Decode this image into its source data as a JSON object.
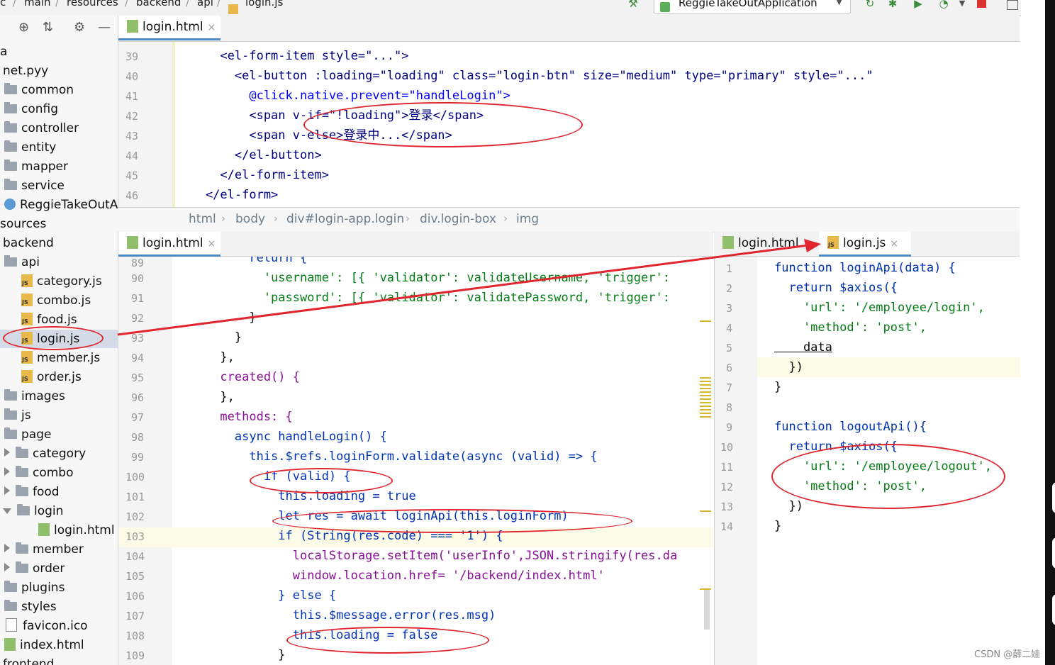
{
  "breadcrumb": [
    "c",
    "main",
    "resources",
    "backend",
    "api",
    "login.js"
  ],
  "run_config": {
    "label": "ReggieTakeOutApplication"
  },
  "project": {
    "items": [
      {
        "label": "a",
        "kind": "text"
      },
      {
        "label": "net.pyy",
        "kind": "text"
      },
      {
        "label": "common",
        "kind": "folder"
      },
      {
        "label": "config",
        "kind": "folder"
      },
      {
        "label": "controller",
        "kind": "folder"
      },
      {
        "label": "entity",
        "kind": "folder"
      },
      {
        "label": "mapper",
        "kind": "folder"
      },
      {
        "label": "service",
        "kind": "folder"
      },
      {
        "label": "ReggieTakeOutA|",
        "kind": "class"
      },
      {
        "label": "sources",
        "kind": "text"
      },
      {
        "label": "backend",
        "kind": "text"
      },
      {
        "label": "api",
        "kind": "folder"
      },
      {
        "label": "category.js",
        "kind": "js"
      },
      {
        "label": "combo.js",
        "kind": "js"
      },
      {
        "label": "food.js",
        "kind": "js"
      },
      {
        "label": "login.js",
        "kind": "js"
      },
      {
        "label": "member.js",
        "kind": "js"
      },
      {
        "label": "order.js",
        "kind": "js"
      },
      {
        "label": "images",
        "kind": "folder"
      },
      {
        "label": "js",
        "kind": "folder"
      },
      {
        "label": "page",
        "kind": "folder"
      },
      {
        "label": "category",
        "kind": "folder"
      },
      {
        "label": "combo",
        "kind": "folder"
      },
      {
        "label": "food",
        "kind": "folder"
      },
      {
        "label": "login",
        "kind": "folder"
      },
      {
        "label": "login.html",
        "kind": "html"
      },
      {
        "label": "member",
        "kind": "folder"
      },
      {
        "label": "order",
        "kind": "folder"
      },
      {
        "label": "plugins",
        "kind": "folder"
      },
      {
        "label": "styles",
        "kind": "folder"
      },
      {
        "label": "favicon.ico",
        "kind": "ico"
      },
      {
        "label": "index.html",
        "kind": "html"
      },
      {
        "label": "frontend",
        "kind": "text"
      }
    ]
  },
  "tabs": {
    "top": "login.html",
    "bottom_left": "login.html",
    "right_first": "login.html",
    "right_second": "login.js",
    "close": "×"
  },
  "path_bar": [
    "html",
    "body",
    "div#login-app.login",
    "div.login-box",
    "img"
  ],
  "top_editor": {
    "line_numbers": [
      "39",
      "40",
      "41",
      "42",
      "43",
      "44",
      "45",
      "46"
    ],
    "lines": [
      "      <el-form-item style=\"...\">",
      "        <el-button :loading=\"loading\" class=\"login-btn\" size=\"medium\" type=\"primary\" style=\"...\"",
      "          @click.native.prevent=\"handleLogin\">",
      "          <span v-if=\"!loading\">登录</span>",
      "          <span v-else>登录中...</span>",
      "        </el-button>",
      "      </el-form-item>",
      "    </el-form>"
    ]
  },
  "left_editor": {
    "line_numbers": [
      "89",
      "90",
      "91",
      "92",
      "93",
      "94",
      "95",
      "96",
      "97",
      "98",
      "99",
      "100",
      "101",
      "102",
      "103",
      "104",
      "105",
      "106",
      "107",
      "108",
      "109"
    ],
    "lines": [
      "          return {",
      "            'username': [{ 'validator': validateUsername, 'trigger': ",
      "            'password': [{ 'validator': validatePassword, 'trigger': ",
      "          }",
      "        }",
      "      },",
      "      created() {",
      "      },",
      "      methods: {",
      "        async handleLogin() {",
      "          this.$refs.loginForm.validate(async (valid) => {",
      "            if (valid) {",
      "              this.loading = true",
      "              let res = await loginApi(this.loginForm)",
      "              if (String(res.code) === '1') {",
      "                localStorage.setItem('userInfo',JSON.stringify(res.da",
      "                window.location.href= '/backend/index.html'",
      "              } else {",
      "                this.$message.error(res.msg)",
      "                this.loading = false",
      "              }"
    ]
  },
  "right_editor": {
    "line_numbers": [
      "1",
      "2",
      "3",
      "4",
      "5",
      "6",
      "7",
      "8",
      "9",
      "10",
      "11",
      "12",
      "13",
      "14"
    ],
    "lines": [
      "function loginApi(data) {",
      "  return $axios({",
      "    'url': '/employee/login',",
      "    'method': 'post',",
      "    data",
      "  })",
      "}",
      "",
      "function logoutApi(){",
      "  return $axios({",
      "    'url': '/employee/logout',",
      "    'method': 'post',",
      "  })",
      "}"
    ]
  },
  "watermark": "CSDN @薛二娃",
  "colors": {
    "annotation": "#e0252e",
    "accent": "#4a88c7"
  }
}
